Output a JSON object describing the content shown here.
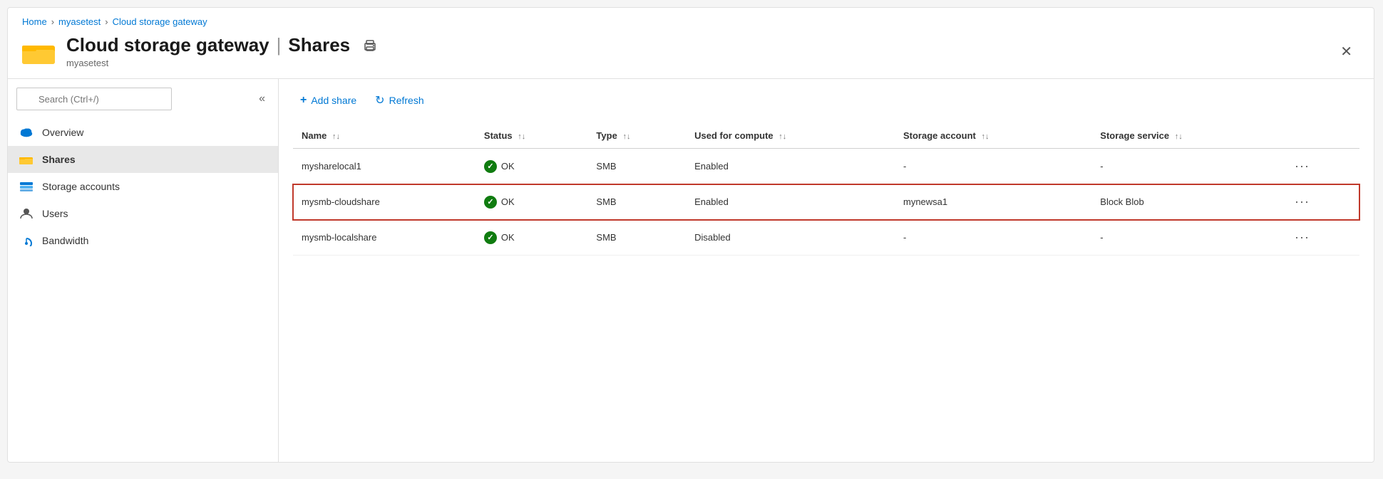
{
  "breadcrumb": {
    "home": "Home",
    "myasetest": "myasetest",
    "current": "Cloud storage gateway"
  },
  "header": {
    "title": "Cloud storage gateway",
    "pipe": "|",
    "section": "Shares",
    "subtitle": "myasetest"
  },
  "search": {
    "placeholder": "Search (Ctrl+/)"
  },
  "sidebar": {
    "collapse_label": "«",
    "items": [
      {
        "label": "Overview",
        "icon": "cloud-icon",
        "active": false
      },
      {
        "label": "Shares",
        "icon": "folder-icon",
        "active": true
      },
      {
        "label": "Storage accounts",
        "icon": "storage-icon",
        "active": false
      },
      {
        "label": "Users",
        "icon": "user-icon",
        "active": false
      },
      {
        "label": "Bandwidth",
        "icon": "bandwidth-icon",
        "active": false
      }
    ]
  },
  "toolbar": {
    "add_share": "Add share",
    "refresh": "Refresh"
  },
  "table": {
    "columns": [
      {
        "label": "Name"
      },
      {
        "label": "Status"
      },
      {
        "label": "Type"
      },
      {
        "label": "Used for compute"
      },
      {
        "label": "Storage account"
      },
      {
        "label": "Storage service"
      }
    ],
    "rows": [
      {
        "name": "mysharelocal1",
        "status": "OK",
        "type": "SMB",
        "used_for_compute": "Enabled",
        "storage_account": "-",
        "storage_service": "-",
        "highlighted": false
      },
      {
        "name": "mysmb-cloudshare",
        "status": "OK",
        "type": "SMB",
        "used_for_compute": "Enabled",
        "storage_account": "mynewsa1",
        "storage_service": "Block Blob",
        "highlighted": true
      },
      {
        "name": "mysmb-localshare",
        "status": "OK",
        "type": "SMB",
        "used_for_compute": "Disabled",
        "storage_account": "-",
        "storage_service": "-",
        "highlighted": false
      }
    ]
  }
}
